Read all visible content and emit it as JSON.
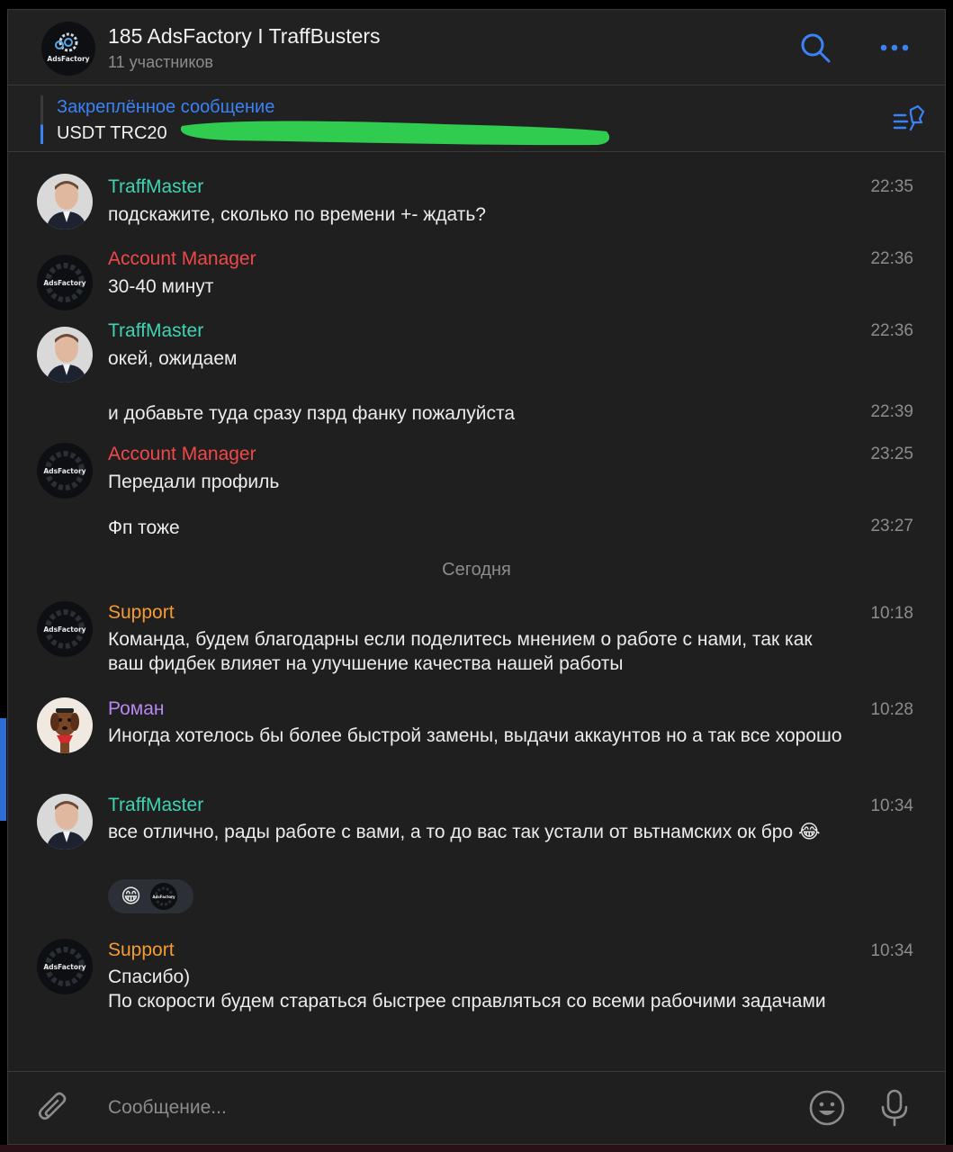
{
  "header": {
    "title": "185 AdsFactory I TraffBusters",
    "subtitle": "11 участников",
    "logo_text": "AdsFactory"
  },
  "pinned": {
    "title": "Закреплённое сообщение",
    "text": "USDT TRC20"
  },
  "messages": [
    {
      "sender": "TraffMaster",
      "text": "подскажите, сколько по времени +- ждать?",
      "time": "22:35"
    },
    {
      "sender": "Account Manager",
      "text": "30-40 минут",
      "time": "22:36"
    },
    {
      "sender": "TraffMaster",
      "text": "окей, ожидаем",
      "time": "22:36"
    },
    {
      "sender": "",
      "text": "и добавьте туда сразу пзрд фанку пожалуйста",
      "time": "22:39"
    },
    {
      "sender": "Account Manager",
      "text": "Передали профиль",
      "time": "23:25"
    },
    {
      "sender": "",
      "text": "Фп тоже",
      "time": "23:27"
    },
    {
      "sender": "Support",
      "text": "Команда, будем благодарны если поделитесь мнением о работе с нами, так как ваш фидбек влияет на улучшение качества нашей работы",
      "time": "10:18"
    },
    {
      "sender": "Роман",
      "text": "Иногда хотелось бы более быстрой замены, выдачи аккаунтов но а так все хорошо",
      "time": "10:28"
    },
    {
      "sender": "TraffMaster",
      "text": "все отлично, рады работе с вами, а то до вас так устали от вьтнамских ок бро 😂",
      "time": "10:34",
      "reaction": "😁"
    },
    {
      "sender": "Support",
      "text": "Спасибо)\nПо скорости будем стараться быстрее справляться со всеми рабочими задачами",
      "time": "10:34"
    }
  ],
  "date_separator": "Сегодня",
  "composer": {
    "placeholder": "Сообщение..."
  },
  "colors": {
    "accent": "#3b82f6",
    "traffmaster": "#3fd3b3",
    "account_manager": "#f04848",
    "support": "#f59b32",
    "roman": "#b887f0",
    "redaction": "#2fcc4f"
  },
  "icons": [
    "search-icon",
    "more-icon",
    "pin-list-icon",
    "attach-icon",
    "emoji-icon",
    "mic-icon"
  ]
}
